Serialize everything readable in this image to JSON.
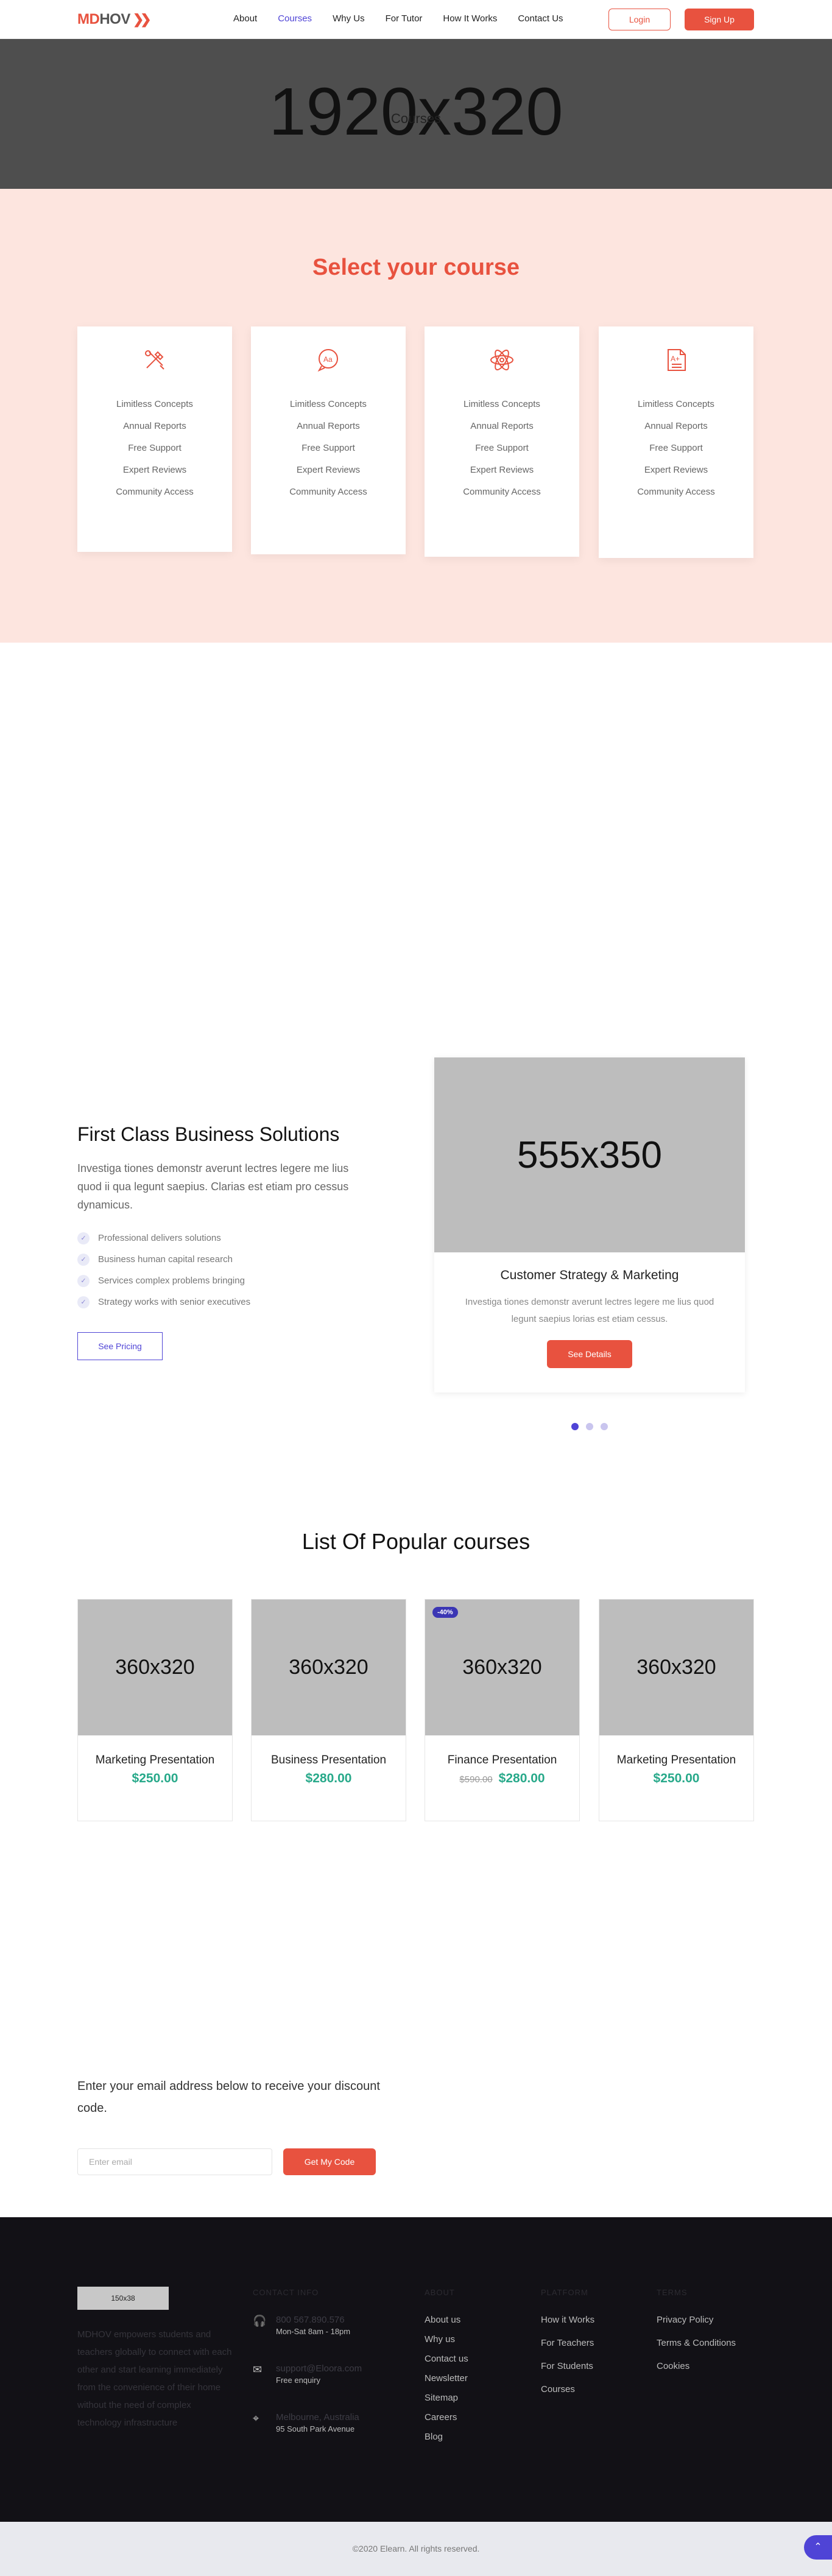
{
  "header": {
    "logo_md": "MD",
    "logo_hov": "HOV",
    "nav": [
      "About",
      "Courses",
      "Why Us",
      "For Tutor",
      "How It Works",
      "Contact Us"
    ],
    "login": "Login",
    "signup": "Sign Up"
  },
  "hero": {
    "dimensions": "1920x320",
    "title": "Courses"
  },
  "select": {
    "title": "Select your course",
    "cards": [
      {
        "icon": "tools-icon",
        "items": [
          "Limitless Concepts",
          "Annual Reports",
          "Free Support",
          "Expert Reviews",
          "Community Access"
        ]
      },
      {
        "icon": "language-chat-icon",
        "items": [
          "Limitless Concepts",
          "Annual Reports",
          "Free Support",
          "Expert Reviews",
          "Community Access"
        ]
      },
      {
        "icon": "atom-icon",
        "items": [
          "Limitless Concepts",
          "Annual Reports",
          "Free Support",
          "Expert Reviews",
          "Community Access"
        ]
      },
      {
        "icon": "grade-document-icon",
        "items": [
          "Limitless Concepts",
          "Annual Reports",
          "Free Support",
          "Expert Reviews",
          "Community Access"
        ]
      }
    ]
  },
  "business": {
    "title": "First Class Business Solutions",
    "text": "Investiga tiones demonstr averunt lectres legere me lius quod ii qua legunt saepius. Clarias est etiam pro cessus dynamicus.",
    "list": [
      "Professional delivers solutions",
      "Business human capital research",
      "Services complex problems bringing",
      "Strategy works with senior executives"
    ],
    "pricing": "See Pricing",
    "slide": {
      "image": "555x350",
      "title": "Customer Strategy & Marketing",
      "text": "Investiga tiones demonstr averunt lectres legere me lius quod legunt saepius lorias est etiam cessus.",
      "button": "See Details"
    }
  },
  "popular": {
    "title": "List Of Popular courses",
    "courses": [
      {
        "image": "360x320",
        "name": "Marketing Presentation",
        "price": "$250.00",
        "old_price": "",
        "badge": ""
      },
      {
        "image": "360x320",
        "name": "Business Presentation",
        "price": "$280.00",
        "old_price": "",
        "badge": ""
      },
      {
        "image": "360x320",
        "name": "Finance Presentation",
        "price": "$280.00",
        "old_price": "$590.00",
        "badge": "-40%"
      },
      {
        "image": "360x320",
        "name": "Marketing Presentation",
        "price": "$250.00",
        "old_price": "",
        "badge": ""
      }
    ]
  },
  "discount": {
    "text": "Enter your email address below to receive your discount code.",
    "placeholder": "Enter email",
    "button": "Get My Code"
  },
  "footer": {
    "logo": "150x38",
    "about": "MDHOV empowers students and teachers globally to connect with each other and start learning immediately from the convenience of their home without the need of complex technology infrastructure",
    "contact_head": "CONTACT INFO",
    "contacts": [
      {
        "icon": "headphones-icon",
        "t1": "800 567.890.576",
        "t2": "Mon-Sat 8am - 18pm"
      },
      {
        "icon": "mail-icon",
        "t1": "support@Eloora.com",
        "t2": "Free enquiry"
      },
      {
        "icon": "location-pin-icon",
        "t1": "Melbourne, Australia",
        "t2": "95 South Park Avenue"
      }
    ],
    "about_head": "ABOUT",
    "about_links": [
      "About us",
      "Why us",
      "Contact us",
      "Newsletter",
      "Sitemap",
      "Careers",
      "Blog"
    ],
    "platform_head": "PLATFORM",
    "platform_links": [
      "How it Works",
      "For Teachers",
      "For Students",
      "Courses"
    ],
    "terms_head": "TERMS",
    "terms_links": [
      "Privacy Policy",
      "Terms & Conditions",
      "Cookies"
    ],
    "copyright": "©2020 Elearn. All rights reserved."
  }
}
